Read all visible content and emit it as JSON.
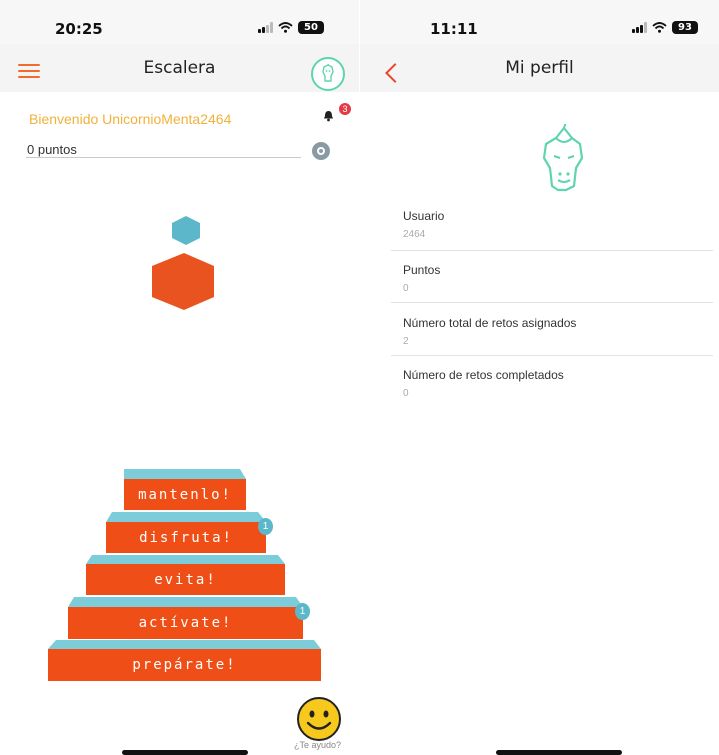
{
  "left_screen": {
    "status": {
      "time": "20:25",
      "battery": "50"
    },
    "title": "Escalera",
    "welcome": "Bienvenido UnicornioMenta2464",
    "notifications": "3",
    "points": "0 puntos",
    "steps": [
      {
        "label": "mantenlo!",
        "badge": ""
      },
      {
        "label": "disfruta!",
        "badge": "1"
      },
      {
        "label": "evita!",
        "badge": ""
      },
      {
        "label": "actívate!",
        "badge": "1"
      },
      {
        "label": "prepárate!",
        "badge": ""
      }
    ],
    "helper_text": "¿Te ayudo?",
    "colors": {
      "accent": "#f26a2e",
      "teal": "#5bb7c9",
      "mint": "#5fd4b0",
      "gold": "#f0b23a"
    }
  },
  "right_screen": {
    "status": {
      "time": "11:11",
      "battery": "93"
    },
    "title": "Mi perfil",
    "fields": [
      {
        "label": "Usuario",
        "value": "2464"
      },
      {
        "label": "Puntos",
        "value": "0"
      },
      {
        "label": "Número total de retos asignados",
        "value": "2"
      },
      {
        "label": "Número de retos completados",
        "value": "0"
      }
    ]
  }
}
